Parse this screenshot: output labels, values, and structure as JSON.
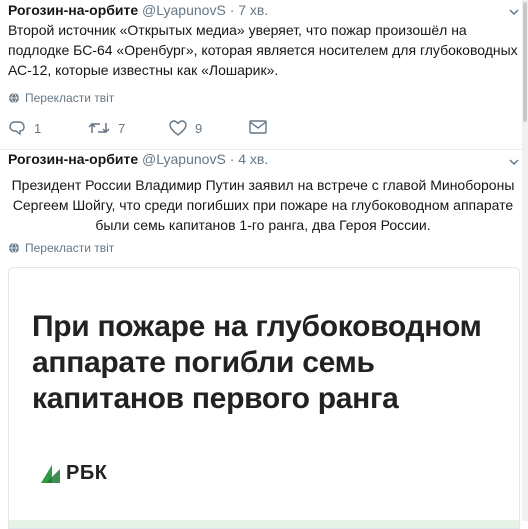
{
  "tweets": [
    {
      "name": "Рогозин-на-орбите",
      "handle": "@LyapunovS",
      "time": "7 хв.",
      "text": "Второй источник «Открытых медиа» уверяет, что пожар произошёл на подлодке БС-64 «Оренбург», которая является носителем для глубоководных АС-12, которые известны как «Лошарик».",
      "translate": "Перекласти твіт",
      "actions": {
        "replies": "1",
        "retweets": "7",
        "likes": "9"
      }
    },
    {
      "name": "Рогозин-на-орбите",
      "handle": "@LyapunovS",
      "time": "4 хв.",
      "text": "Президент России Владимир Путин заявил на встрече с главой Минобороны Сергеем Шойгу, что среди погибших при пожаре на глубоководном аппарате были семь капитанов 1-го ранга, два Героя России.",
      "translate": "Перекласти твіт",
      "card": {
        "headline": "При пожаре на глубоководном аппарате погибли семь капитанов первого ранга",
        "brand": "РБК"
      }
    }
  ],
  "colors": {
    "name": "#14171a",
    "meta": "#657786",
    "brand_green": "#2e9a47"
  },
  "icons": [
    "chevron-down-icon",
    "globe-icon",
    "reply-icon",
    "retweet-icon",
    "like-icon",
    "message-icon",
    "rbc-logo-icon"
  ]
}
